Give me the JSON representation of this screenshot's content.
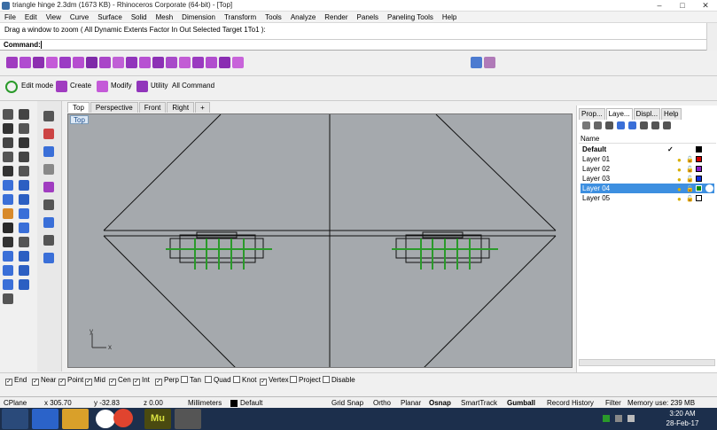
{
  "window": {
    "title": "triangle hinge 2.3dm (1673 KB) - Rhinoceros Corporate (64-bit) - [Top]",
    "min": "–",
    "max": "□",
    "close": "✕"
  },
  "menu": [
    "File",
    "Edit",
    "View",
    "Curve",
    "Surface",
    "Solid",
    "Mesh",
    "Dimension",
    "Transform",
    "Tools",
    "Analyze",
    "Render",
    "Panels",
    "Paneling Tools",
    "Help"
  ],
  "history": "Drag a window to zoom ( All  Dynamic  Extents  Factor  In  Out  Selected  Target  1To1 ):",
  "command": {
    "label": "Command:",
    "value": ""
  },
  "toolbar2": [
    {
      "label": "Edit mode"
    },
    {
      "label": "Create"
    },
    {
      "label": "Modify"
    },
    {
      "label": "Utility"
    },
    {
      "label": "All Command"
    }
  ],
  "viewport_tabs": [
    "Top",
    "Perspective",
    "Front",
    "Right",
    "+"
  ],
  "viewport_label": "Top",
  "axis": {
    "y": "y",
    "x": "x"
  },
  "panel_tabs": [
    "Prop...",
    "Laye...",
    "Displ...",
    "Help"
  ],
  "layers": {
    "header": "Name",
    "rows": [
      {
        "name": "Default",
        "color": "#000000",
        "current": "✓"
      },
      {
        "name": "Layer 01",
        "color": "#d10000"
      },
      {
        "name": "Layer 02",
        "color": "#8a1fc9"
      },
      {
        "name": "Layer 03",
        "color": "#1030e0"
      },
      {
        "name": "Layer 04",
        "color": "#0a8a0a"
      },
      {
        "name": "Layer 05",
        "color": "#ffffff"
      }
    ]
  },
  "osnaps": [
    {
      "label": "End",
      "checked": true
    },
    {
      "label": "Near",
      "checked": true
    },
    {
      "label": "Point",
      "checked": true
    },
    {
      "label": "Mid",
      "checked": true
    },
    {
      "label": "Cen",
      "checked": true
    },
    {
      "label": "Int",
      "checked": true
    },
    {
      "label": "Perp",
      "checked": true
    },
    {
      "label": "Tan",
      "checked": false
    },
    {
      "label": "Quad",
      "checked": false
    },
    {
      "label": "Knot",
      "checked": false
    },
    {
      "label": "Vertex",
      "checked": true
    },
    {
      "label": "Project",
      "checked": false
    },
    {
      "label": "Disable",
      "checked": false
    }
  ],
  "status": {
    "cplane": "CPlane",
    "x": "x 305.70",
    "y": "y -32.83",
    "z": "z 0.00",
    "units": "Millimeters",
    "layer": "Default",
    "grid_snap": "Grid Snap",
    "ortho": "Ortho",
    "planar": "Planar",
    "osnap": "Osnap",
    "smarttrack": "SmartTrack",
    "gumball": "Gumball",
    "record_history": "Record History",
    "filter": "Filter",
    "memory": "Memory use: 239 MB"
  },
  "taskbar": {
    "time": "3:20 AM",
    "date": "28-Feb-17",
    "mu_label": "Mu"
  },
  "colors": {
    "viewport_bg": "#a5a9ad",
    "selected_row": "#3d8fe0",
    "taskbar": "#1c2f4c"
  }
}
